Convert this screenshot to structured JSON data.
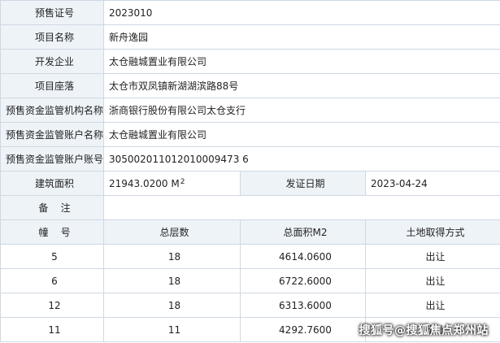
{
  "info": {
    "presale_no_label": "预售证号",
    "presale_no": "2023010",
    "project_name_label": "项目名称",
    "project_name": "新舟逸园",
    "developer_label": "开发企业",
    "developer": "太仓融城置业有限公司",
    "location_label": "项目座落",
    "location": "太仓市双凤镇新湖湖滨路88号",
    "bank_label": "预售资金监管机构名称",
    "bank": "浙商银行股份有限公司太仓支行",
    "account_name_label": "预售资金监管账户名称",
    "account_name": "太仓融城置业有限公司",
    "account_no_label": "预售资金监管账户账号",
    "account_no": "305002011012010009473 6",
    "area_label": "建筑面积",
    "area": "21943.0200 M",
    "area_sup": "2",
    "issue_date_label": "发证日期",
    "issue_date": "2023-04-24",
    "remarks_label": "备    注",
    "remarks": ""
  },
  "buildings": {
    "headers": [
      "幢    号",
      "总层数",
      "总面积M2",
      "土地取得方式"
    ],
    "rows": [
      [
        "5",
        "18",
        "4614.0600",
        "出让"
      ],
      [
        "6",
        "18",
        "6722.6000",
        "出让"
      ],
      [
        "12",
        "18",
        "6313.6000",
        "出让"
      ],
      [
        "11",
        "11",
        "4292.7600",
        "出让"
      ]
    ]
  },
  "watermark": "搜狐号@搜狐焦点郑州站"
}
